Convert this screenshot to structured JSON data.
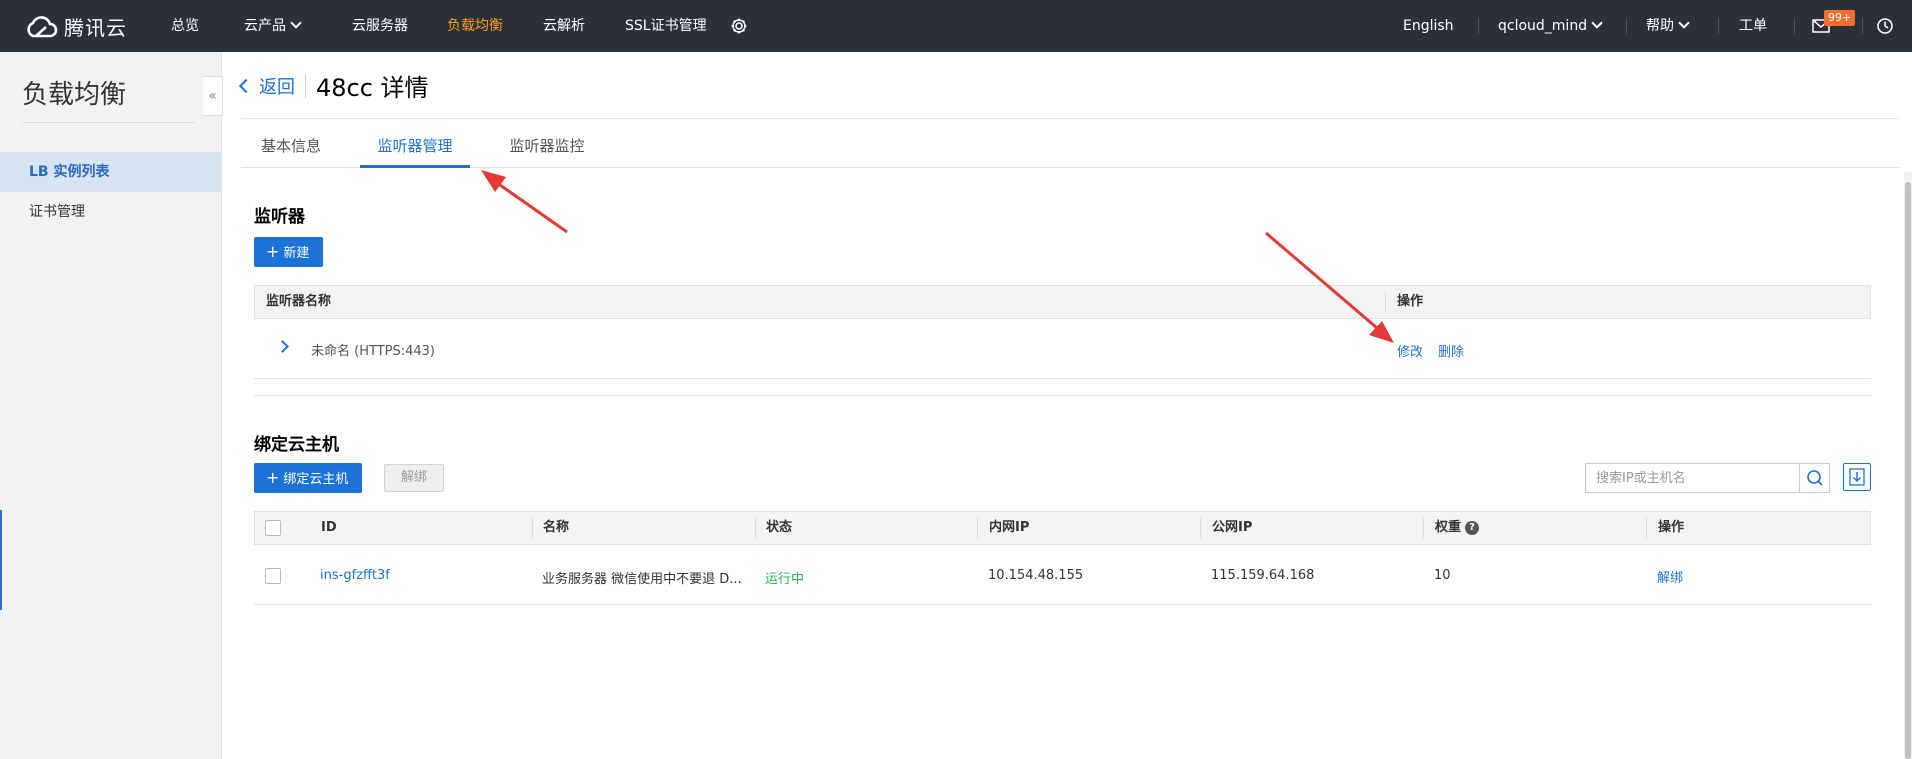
{
  "topbar": {
    "brand": "腾讯云",
    "nav": [
      {
        "label": "总览"
      },
      {
        "label": "云产品"
      },
      {
        "label": "云服务器"
      },
      {
        "label": "负载均衡"
      },
      {
        "label": "云解析"
      },
      {
        "label": "SSL证书管理"
      }
    ],
    "right": {
      "language": "English",
      "user": "qcloud_mind",
      "help": "帮助",
      "ticket": "工单",
      "message_badge": "99+"
    },
    "icons": [
      "settings-icon",
      "mail-icon",
      "history-icon",
      "cloud-logo-icon"
    ],
    "colors": {
      "bar": "#2b303b",
      "active": "#ff9c19",
      "badge": "#f56c2d"
    }
  },
  "sidebar": {
    "title": "负载均衡",
    "items": [
      {
        "label": "LB 实例列表",
        "active": true
      },
      {
        "label": "证书管理",
        "active": false
      }
    ],
    "collapse_glyph": "«"
  },
  "header": {
    "back_label": "返回",
    "title": "48cc 详情"
  },
  "tabs": [
    {
      "label": "基本信息",
      "active": false
    },
    {
      "label": "监听器管理",
      "active": true
    },
    {
      "label": "监听器监控",
      "active": false
    }
  ],
  "listeners": {
    "section_title": "监听器",
    "new_button": "新建",
    "columns": [
      "监听器名称",
      "操作"
    ],
    "rows": [
      {
        "name": "未命名 (HTTPS:443)",
        "actions": [
          "修改",
          "删除"
        ]
      }
    ]
  },
  "bindings": {
    "section_title": "绑定云主机",
    "bind_button": "绑定云主机",
    "unbind_button": "解绑",
    "search_placeholder": "搜索IP或主机名",
    "columns": [
      "ID",
      "名称",
      "状态",
      "内网IP",
      "公网IP",
      "权重",
      "操作"
    ],
    "rows": [
      {
        "id": "ins-gfzfft3f",
        "name": "业务服务器 微信使用中不要退 D...",
        "status": "运行中",
        "private_ip": "10.154.48.155",
        "public_ip": "115.159.64.168",
        "weight": "10",
        "action": "解绑"
      }
    ]
  },
  "colors": {
    "accent": "#1c72d6",
    "status_ok": "#2bb65a",
    "annotation_arrow": "#e53935"
  }
}
